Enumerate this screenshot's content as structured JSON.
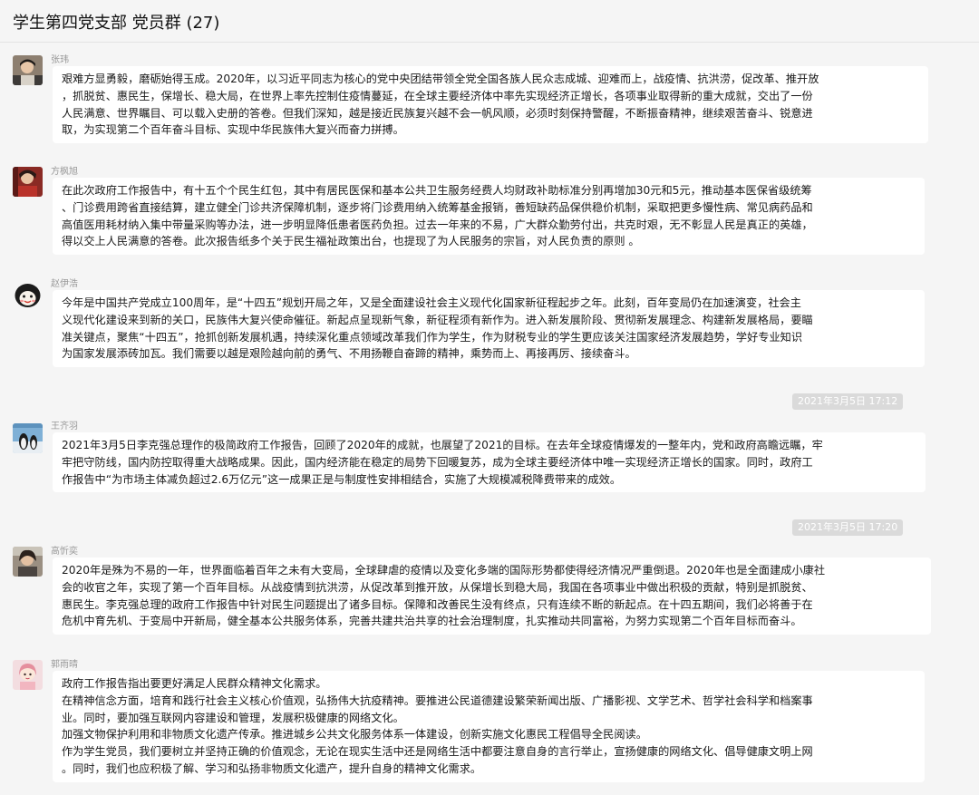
{
  "window": {
    "title": "学生第四党支部 党员群 (27)"
  },
  "messages": [
    {
      "sender": "张玮",
      "lines": [
        "艰难方显勇毅，磨砺始得玉成。2020年，以习近平同志为核心的党中央团结带领全党全国各族人民众志成城、迎难而上，战疫情、抗洪涝，促改革、推开放",
        "，抓脱贫、惠民生，保增长、稳大局，在世界上率先控制住疫情蔓延，在全球主要经济体中率先实现经济正增长，各项事业取得新的重大成就，交出了一份",
        "人民满意、世界瞩目、可以载入史册的答卷。但我们深知，越是接近民族复兴越不会一帆风顺，必须时刻保持警醒，不断振奋精神，继续艰苦奋斗、锐意进",
        "取，为实现第二个百年奋斗目标、实现中华民族伟大复兴而奋力拼搏。"
      ]
    },
    {
      "sender": "方枫旭",
      "lines": [
        "在此次政府工作报告中，有十五个个民生红包，其中有居民医保和基本公共卫生服务经费人均财政补助标准分别再增加30元和5元，推动基本医保省级统筹",
        "、门诊费用跨省直接结算，建立健全门诊共济保障机制，逐步将门诊费用纳入统筹基金报销，善短缺药品保供稳价机制，采取把更多慢性病、常见病药品和",
        "高值医用耗材纳入集中带量采购等办法，进一步明显降低患者医药负担。过去一年来的不易，广大群众勤劳付出，共克时艰，无不彰显人民是真正的英雄，",
        "得以交上人民满意的答卷。此次报告纸多个关于民生福祉政策出台，也提现了为人民服务的宗旨，对人民负责的原则 。"
      ]
    },
    {
      "sender": "赵伊浩",
      "lines": [
        "今年是中国共产党成立100周年，是“十四五”规划开局之年，又是全面建设社会主义现代化国家新征程起步之年。此刻，百年变局仍在加速演变，社会主",
        "义现代化建设来到新的关口，民族伟大复兴使命催征。新起点呈现新气象，新征程须有新作为。进入新发展阶段、贯彻新发展理念、构建新发展格局，要瞄",
        "准关键点，聚焦“十四五”，抢抓创新发展机遇，持续深化重点领域改革我们作为学生，作为财税专业的学生更应该关注国家经济发展趋势，学好专业知识",
        "为国家发展添砖加瓦。我们需要以越是艰险越向前的勇气、不用扬鞭自奋蹄的精神，乘势而上、再接再厉、接续奋斗。"
      ]
    },
    {
      "sender": "王齐羽",
      "lines": [
        "2021年3月5日李克强总理作的极简政府工作报告，回顾了2020年的成就，也展望了2021的目标。在去年全球疫情爆发的一整年内，党和政府高瞻远瞩，牢",
        "牢把守防线，国内防控取得重大战略成果。因此，国内经济能在稳定的局势下回暖复苏，成为全球主要经济体中唯一实现经济正增长的国家。同时，政府工",
        "作报告中“为市场主体减负超过2.6万亿元”这一成果正是与制度性安排相结合，实施了大规模减税降费带来的成效。"
      ]
    },
    {
      "sender": "高忻奕",
      "lines": [
        "2020年是殊为不易的一年，世界面临着百年之未有大变局，全球肆虐的疫情以及变化多端的国际形势都使得经济情况严重倒退。2020年也是全面建成小康社",
        "会的收官之年，实现了第一个百年目标。从战疫情到抗洪涝，从促改革到推开放，从保增长到稳大局，我国在各项事业中做出积极的贡献，特别是抓脱贫、",
        "惠民生。李克强总理的政府工作报告中针对民生问题提出了诸多目标。保障和改善民生没有终点，只有连续不断的新起点。在十四五期间，我们必将善于在",
        "危机中育先机、于变局中开新局，健全基本公共服务体系，完善共建共治共享的社会治理制度，扎实推动共同富裕，为努力实现第二个百年目标而奋斗。"
      ]
    },
    {
      "sender": "郭雨晴",
      "lines": [
        "政府工作报告指出要更好满足人民群众精神文化需求。",
        "在精神信念方面，培育和践行社会主义核心价值观，弘扬伟大抗疫精神。要推进公民道德建设繁荣新闻出版、广播影视、文学艺术、哲学社会科学和档案事",
        "业。同时，要加强互联网内容建设和管理，发展积极健康的网络文化。",
        "加强文物保护利用和非物质文化遗产传承。推进城乡公共文化服务体系一体建设，创新实施文化惠民工程倡导全民阅读。",
        "作为学生党员，我们要树立并坚持正确的价值观念，无论在现实生活中还是网络生活中都要注意自身的言行举止，宣扬健康的网络文化、倡导健康文明上网",
        "。同时，我们也应积极了解、学习和弘扬非物质文化遗产，提升自身的精神文化需求。"
      ]
    }
  ],
  "timestamps": [
    "2021年3月5日 17:12",
    "2021年3月5日 17:20"
  ]
}
